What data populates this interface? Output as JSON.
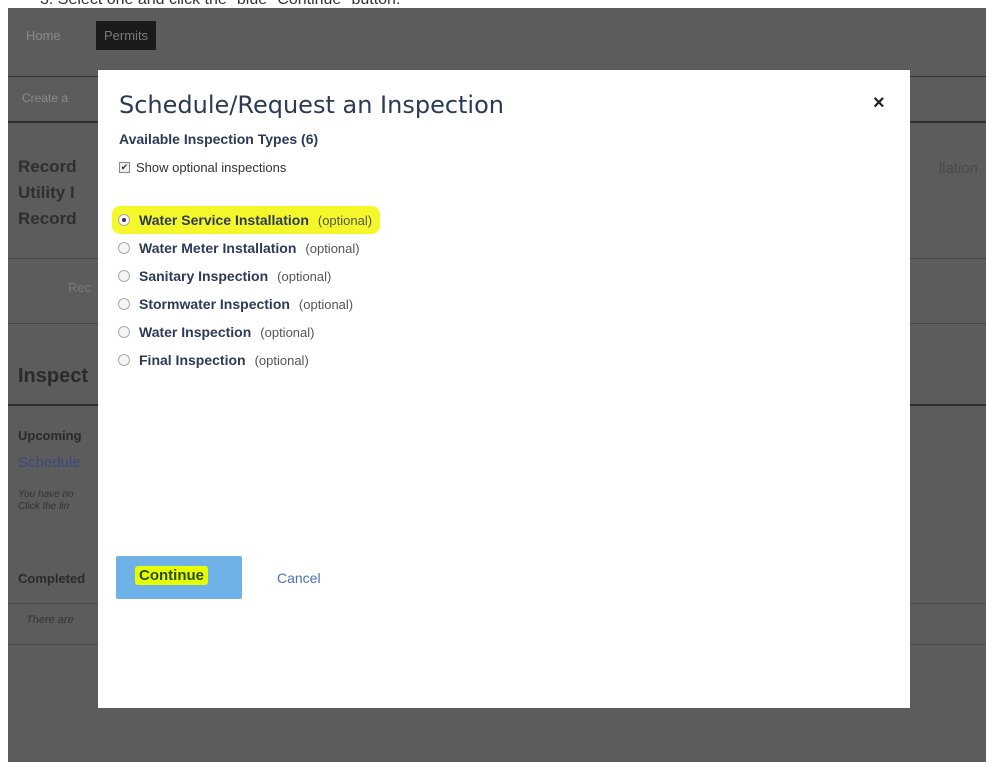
{
  "instruction": "3.  Select one and click the \"blue\" Continue\" button.",
  "background": {
    "nav": [
      "Home",
      "Permits"
    ],
    "subnav": "Create a",
    "record_lines": [
      "Record",
      "Utility I",
      "Record"
    ],
    "right_text": "llation",
    "rec_label": "Rec",
    "inspections_heading": "Inspect",
    "upcoming": "Upcoming",
    "schedule_link": "Schedule",
    "small_line_1": "You have no",
    "small_line_2": "Click the lin",
    "completed": "Completed",
    "there_are": "There are"
  },
  "modal": {
    "title": "Schedule/Request an Inspection",
    "close_glyph": "×",
    "subtitle": "Available Inspection Types (6)",
    "show_optional_label": "Show optional inspections",
    "show_optional_checked": true,
    "options": [
      {
        "label": "Water Service Installation",
        "tag": "(optional)",
        "selected": true
      },
      {
        "label": "Water Meter Installation",
        "tag": "(optional)",
        "selected": false
      },
      {
        "label": "Sanitary Inspection",
        "tag": "(optional)",
        "selected": false
      },
      {
        "label": "Stormwater Inspection",
        "tag": "(optional)",
        "selected": false
      },
      {
        "label": "Water Inspection",
        "tag": "(optional)",
        "selected": false
      },
      {
        "label": "Final Inspection",
        "tag": "(optional)",
        "selected": false
      }
    ],
    "continue_label": "Continue",
    "cancel_label": "Cancel"
  },
  "colors": {
    "overlay": "#5c5c5c",
    "highlight": "#f4f72a",
    "continue_bg": "#6fb2e8"
  }
}
